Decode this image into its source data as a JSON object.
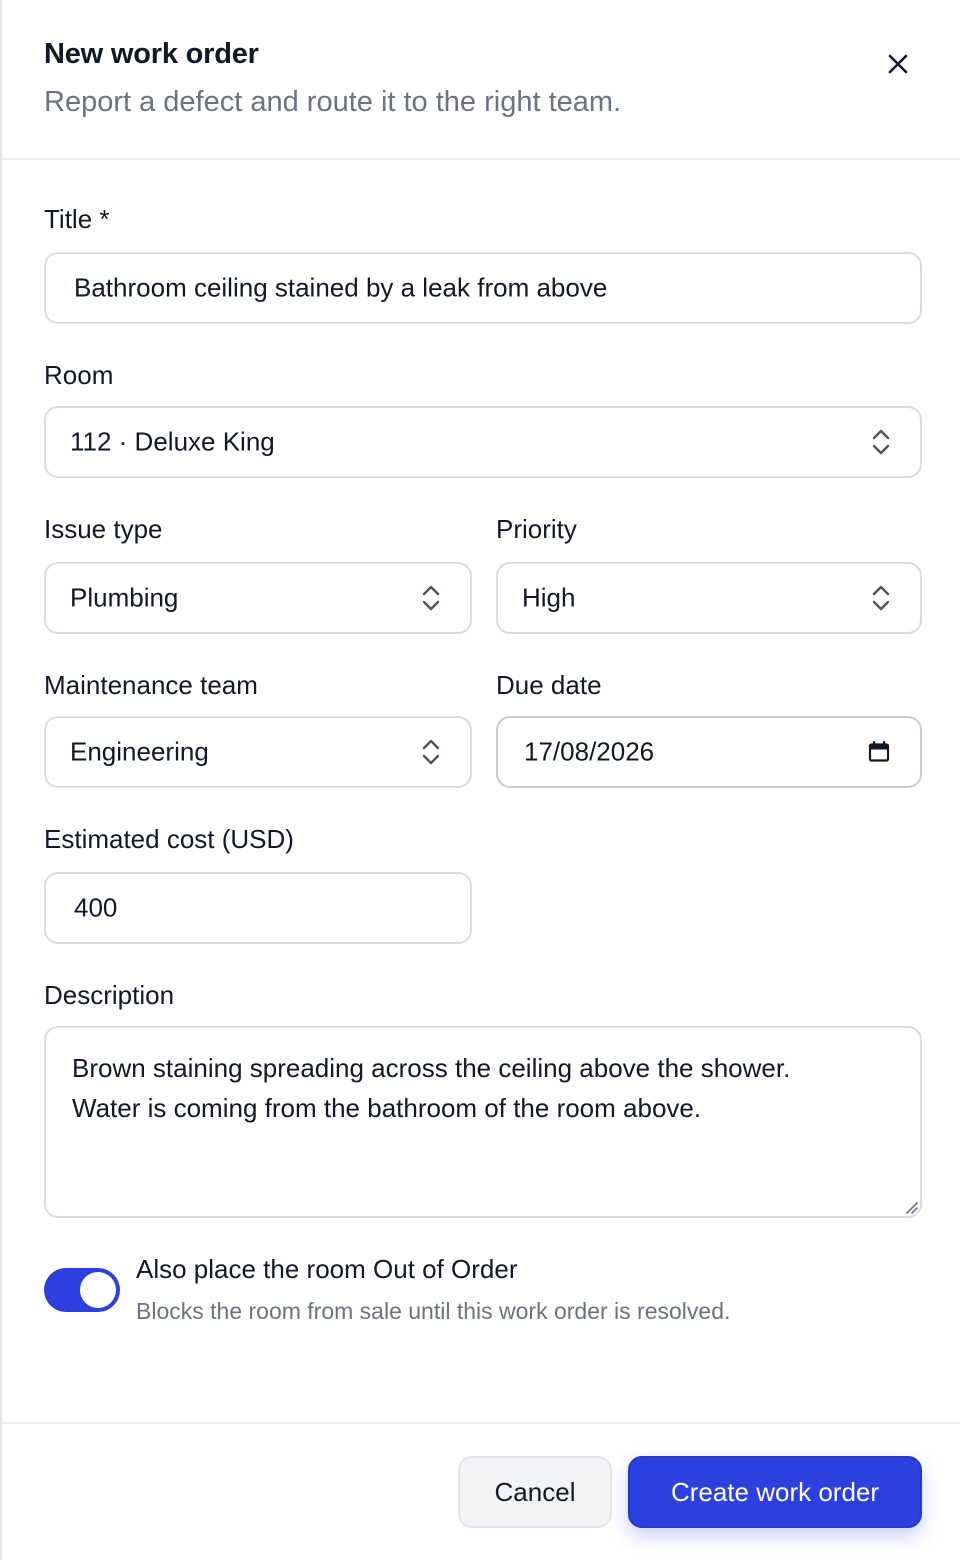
{
  "header": {
    "title": "New work order",
    "subtitle": "Report a defect and route it to the right team."
  },
  "icons": {
    "close": "close-icon",
    "select": "chevron-up-down-icon",
    "calendar": "calendar-icon",
    "resize": "resize-grip-icon"
  },
  "form": {
    "title": {
      "label": "Title *",
      "value": "Bathroom ceiling stained by a leak from above"
    },
    "room": {
      "label": "Room",
      "value": "112 · Deluxe King"
    },
    "issue_type": {
      "label": "Issue type",
      "value": "Plumbing"
    },
    "priority": {
      "label": "Priority",
      "value": "High"
    },
    "team": {
      "label": "Maintenance team",
      "value": "Engineering"
    },
    "due_date": {
      "label": "Due date",
      "value": "17/08/2026"
    },
    "cost": {
      "label": "Estimated cost (USD)",
      "value": "400"
    },
    "description": {
      "label": "Description",
      "line1": "Brown staining spreading across the ceiling above the shower.",
      "line2": "Water is coming from the bathroom of the room above."
    },
    "out_of_order": {
      "label": "Also place the room Out of Order",
      "help": "Blocks the room from sale until this work order is resolved.",
      "checked": true
    }
  },
  "footer": {
    "cancel_label": "Cancel",
    "submit_label": "Create work order"
  },
  "colors": {
    "accent": "#2c40e0",
    "muted_text": "#6b7280",
    "border": "#d9dce1"
  }
}
